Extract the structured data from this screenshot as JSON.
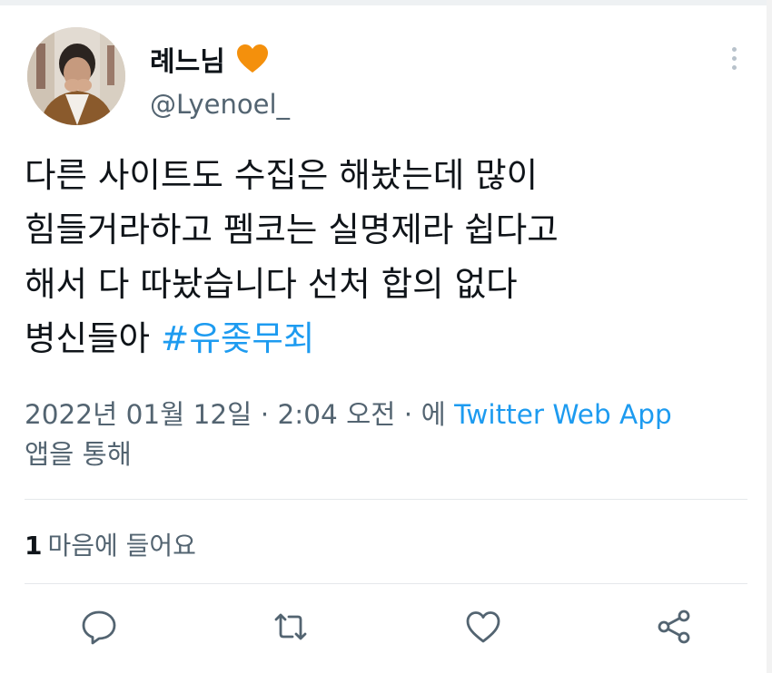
{
  "author": {
    "display_name": "례느님",
    "handle": "@Lyenoel_",
    "badge": "orange-heart-icon"
  },
  "tweet": {
    "lines": [
      "다른 사이트도 수집은 해놨는데 많이",
      "힘들거라하고 펨코는 실명제라 쉽다고",
      "해서 다 따놨습니다 선처 합의 없다"
    ],
    "last_line_text": "병신들아 ",
    "hashtag": "#유좆무죄"
  },
  "meta": {
    "date": "2022년 01월 12일",
    "separator": "·",
    "time": "2:04 오전",
    "via_prefix": "에",
    "source": "Twitter Web App",
    "via_suffix": "앱을 통해"
  },
  "stats": {
    "likes_count": "1",
    "likes_label": "마음에 들어요"
  },
  "actions": {
    "reply": "reply-icon",
    "retweet": "retweet-icon",
    "like": "like-heart-icon",
    "share": "share-icon"
  },
  "colors": {
    "accent": "#1d9bf0",
    "secondary_text": "#536471",
    "badge": "#f4900c"
  }
}
